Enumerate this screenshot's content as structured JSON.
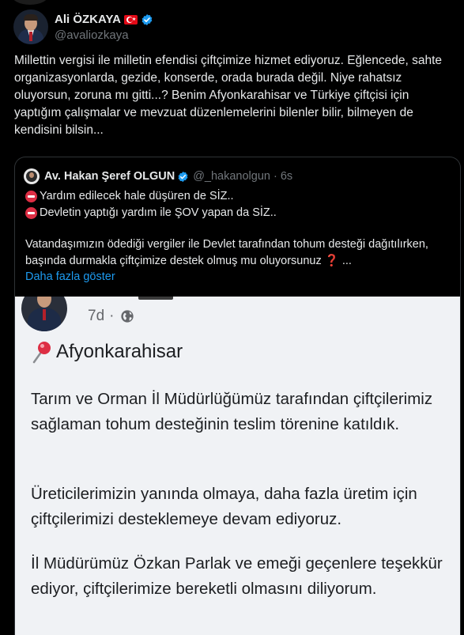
{
  "author": {
    "display_name": "Ali ÖZKAYA",
    "handle": "@avaliozkaya"
  },
  "icons": {
    "flag": "turkey-flag-icon",
    "verified": "verified-badge-icon",
    "no_entry": "no-entry-icon",
    "question": "red-question-mark-icon",
    "globe": "globe-icon",
    "pin": "round-pushpin-icon"
  },
  "colors": {
    "background": "#000000",
    "text": "#e7e9ea",
    "muted": "#71767b",
    "link": "#1d9bf0",
    "verified": "#1d9bf0",
    "border": "#2f3336"
  },
  "tweet": {
    "text": "Millettin vergisi ile milletin efendisi çiftçimize hizmet ediyoruz. Eğlencede, sahte organizasyonlarda, gezide, konserde, orada burada değil. Niye rahatsız oluyorsun, zoruna mı gitti...? Benim Afyonkarahisar ve Türkiye çiftçisi için yaptığım çalışmalar ve mevzuat düzenlemelerini bilenler bilir, bilmeyen de kendisini bilsin..."
  },
  "quote": {
    "display_name": "Av. Hakan Şeref OLGUN",
    "handle": "@_hakanolgun",
    "separator": "·",
    "time": "6s",
    "line1": "Yardım edilecek hale düşüren de SİZ..",
    "line2": "Devletin yaptığı yardım ile ŞOV yapan da SİZ..",
    "body": "Vatandaşımızın ödediği vergiler ile Devlet tarafından tohum desteği dağıtılırken, başında durmakla çiftçimize destek olmuş mu oluyorsunuz",
    "ellipsis": " ...",
    "show_more": "Daha fazla göster"
  },
  "embedded_post": {
    "time": "7d",
    "separator": "·",
    "location": "Afyonkarahisar",
    "para1": "Tarım ve Orman İl Müdürlüğümüz tarafından çiftçilerimiz sağlaman tohum desteğinin teslim törenine katıldık.",
    "para2": "Üreticilerimizin yanında olmaya, daha fazla üretim için çiftçilerimizi desteklemeye devam ediyoruz.",
    "para3": "İl Müdürümüz Özkan Parlak ve emeği geçenlere teşekkür ediyor, çiftçilerimize bereketli olmasını diliyorum."
  }
}
